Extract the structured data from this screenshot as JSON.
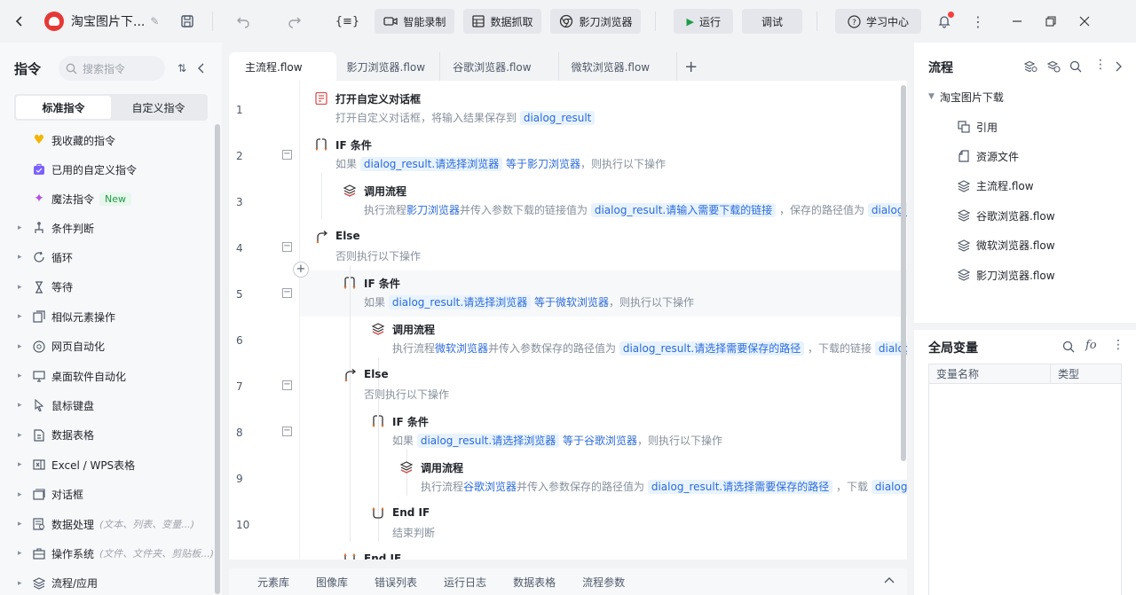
{
  "app": {
    "project_title": "淘宝图片下..."
  },
  "toolbar": {
    "smart_record": "智能录制",
    "data_scrape": "数据抓取",
    "browser": "影刀浏览器",
    "run": "运行",
    "debug": "调试",
    "learning_center": "学习中心",
    "accent_color": "#1f9c4a"
  },
  "left_panel": {
    "title": "指令",
    "search_placeholder": "搜索指令",
    "tabs": [
      "标准指令",
      "自定义指令"
    ],
    "fixed_items": [
      {
        "label": "我收藏的指令",
        "icon": "heart-icon"
      },
      {
        "label": "已用的自定义指令",
        "icon": "briefcase-icon"
      },
      {
        "label": "魔法指令",
        "icon": "sparkle-icon",
        "badge": "New"
      }
    ],
    "categories": [
      {
        "label": "条件判断",
        "icon": "branch-icon",
        "hint": ""
      },
      {
        "label": "循环",
        "icon": "loop-icon",
        "hint": ""
      },
      {
        "label": "等待",
        "icon": "hourglass-icon",
        "hint": ""
      },
      {
        "label": "相似元素操作",
        "icon": "similar-elements-icon",
        "hint": ""
      },
      {
        "label": "网页自动化",
        "icon": "browser-icon",
        "hint": ""
      },
      {
        "label": "桌面软件自动化",
        "icon": "monitor-icon",
        "hint": ""
      },
      {
        "label": "鼠标键盘",
        "icon": "cursor-icon",
        "hint": ""
      },
      {
        "label": "数据表格",
        "icon": "table-icon",
        "hint": ""
      },
      {
        "label": "Excel / WPS表格",
        "icon": "excel-icon",
        "hint": ""
      },
      {
        "label": "对话框",
        "icon": "dialog-icon",
        "hint": ""
      },
      {
        "label": "数据处理",
        "icon": "data-process-icon",
        "hint": "(文本、列表、变量...)"
      },
      {
        "label": "操作系统",
        "icon": "os-icon",
        "hint": "(文件、文件夹、剪贴板...)"
      },
      {
        "label": "流程/应用",
        "icon": "layers-icon",
        "hint": ""
      }
    ]
  },
  "editor": {
    "tabs": [
      "主流程.flow",
      "影刀浏览器.flow",
      "谷歌浏览器.flow",
      "微软浏览器.flow"
    ],
    "line_numbers": [
      "1",
      "2",
      "3",
      "4",
      "5",
      "6",
      "7",
      "8",
      "9",
      "10"
    ],
    "steps": [
      {
        "title": "打开自定义对话框",
        "icon": "dialog-form-icon",
        "desc": [
          {
            "t": "打开自定义对话框，将输入结果保存到 "
          },
          {
            "v": "dialog_result"
          }
        ]
      },
      {
        "title": "IF 条件",
        "icon": "if-icon",
        "desc": [
          {
            "t": "如果 "
          },
          {
            "v": "dialog_result.请选择浏览器"
          },
          {
            "t": " "
          },
          {
            "h": "等于影刀浏览器"
          },
          {
            "t": "，则执行以下操作"
          }
        ]
      },
      {
        "title": "调用流程",
        "icon": "call-flow-icon",
        "desc": [
          {
            "t": "执行流程"
          },
          {
            "h": "影刀浏览器"
          },
          {
            "t": "并传入参数下载的链接值为 "
          },
          {
            "v": "dialog_result.请输入需要下载的链接"
          },
          {
            "t": " ，保存的路径值为 "
          },
          {
            "v": "dialog_result.请选择需要保存的路径"
          }
        ]
      },
      {
        "title": "Else",
        "icon": "else-icon",
        "desc": [
          {
            "t": "否则执行以下操作"
          }
        ]
      },
      {
        "title": "IF 条件",
        "icon": "if-icon",
        "desc": [
          {
            "t": "如果 "
          },
          {
            "v": "dialog_result.请选择浏览器"
          },
          {
            "t": " "
          },
          {
            "h": "等于微软浏览器"
          },
          {
            "t": "，则执行以下操作"
          }
        ]
      },
      {
        "title": "调用流程",
        "icon": "call-flow-icon",
        "desc": [
          {
            "t": "执行流程"
          },
          {
            "h": "微软浏览器"
          },
          {
            "t": "并传入参数保存的路径值为 "
          },
          {
            "v": "dialog_result.请选择需要保存的路径"
          },
          {
            "t": " ，下载的链接 "
          },
          {
            "v": "dialog_result.请输入需要下载的链接"
          }
        ]
      },
      {
        "title": "Else",
        "icon": "else-icon",
        "desc": [
          {
            "t": "否则执行以下操作"
          }
        ]
      },
      {
        "title": "IF 条件",
        "icon": "if-icon",
        "desc": [
          {
            "t": "如果 "
          },
          {
            "v": "dialog_result.请选择浏览器"
          },
          {
            "t": " "
          },
          {
            "h": "等于谷歌浏览器"
          },
          {
            "t": "，则执行以下操作"
          }
        ]
      },
      {
        "title": "调用流程",
        "icon": "call-flow-icon",
        "desc": [
          {
            "t": "执行流程"
          },
          {
            "h": "谷歌浏览器"
          },
          {
            "t": "并传入参数保存的路径值为 "
          },
          {
            "v": "dialog_result.请选择需要保存的路径"
          },
          {
            "t": " ，下载 "
          },
          {
            "v": "dialog_result.请输入需要下载的链接"
          }
        ]
      },
      {
        "title": "End IF",
        "icon": "end-if-icon",
        "desc": [
          {
            "t": "结束判断"
          }
        ]
      },
      {
        "title": "End IF",
        "icon": "end-if-icon",
        "desc": []
      }
    ]
  },
  "bottom_tabs": [
    "元素库",
    "图像库",
    "错误列表",
    "运行日志",
    "数据表格",
    "流程参数"
  ],
  "right_panel": {
    "flow_title": "流程",
    "project_name": "淘宝图片下载",
    "tree_items": [
      {
        "label": "引用",
        "icon": "reference-icon"
      },
      {
        "label": "资源文件",
        "icon": "resource-file-icon"
      },
      {
        "label": "主流程.flow",
        "icon": "flow-layers-icon"
      },
      {
        "label": "谷歌浏览器.flow",
        "icon": "flow-layers-icon"
      },
      {
        "label": "微软浏览器.flow",
        "icon": "flow-layers-icon"
      },
      {
        "label": "影刀浏览器.flow",
        "icon": "flow-layers-icon"
      }
    ],
    "vars_title": "全局变量",
    "var_columns": [
      "变量名称",
      "类型"
    ]
  }
}
